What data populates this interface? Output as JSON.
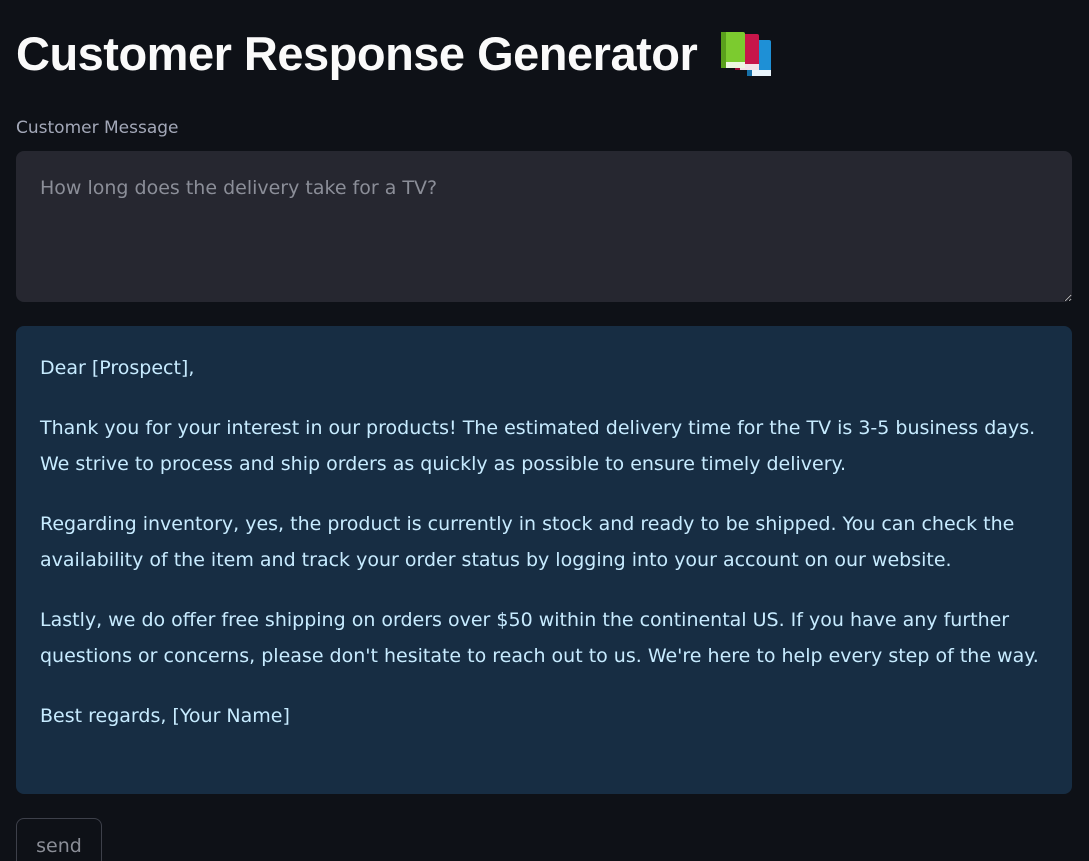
{
  "header": {
    "title": "Customer Response Generator",
    "icon": "books-icon"
  },
  "input": {
    "label": "Customer Message",
    "placeholder": "How long does the delivery take for a TV?",
    "value": ""
  },
  "response": {
    "greeting": "Dear [Prospect],",
    "paragraph_1": "Thank you for your interest in our products! The estimated delivery time for the TV is 3-5 business days. We strive to process and ship orders as quickly as possible to ensure timely delivery.",
    "paragraph_2": "Regarding inventory, yes, the product is currently in stock and ready to be shipped. You can check the availability of the item and track your order status by logging into your account on our website.",
    "paragraph_3": "Lastly, we do offer free shipping on orders over $50 within the continental US. If you have any further questions or concerns, please don't hesitate to reach out to us. We're here to help every step of the way.",
    "closing": "Best regards, [Your Name]"
  },
  "actions": {
    "send_label": "send"
  },
  "colors": {
    "background": "#0e1117",
    "input_background": "#262730",
    "response_background": "#172d43",
    "response_text": "#c7ebff"
  }
}
